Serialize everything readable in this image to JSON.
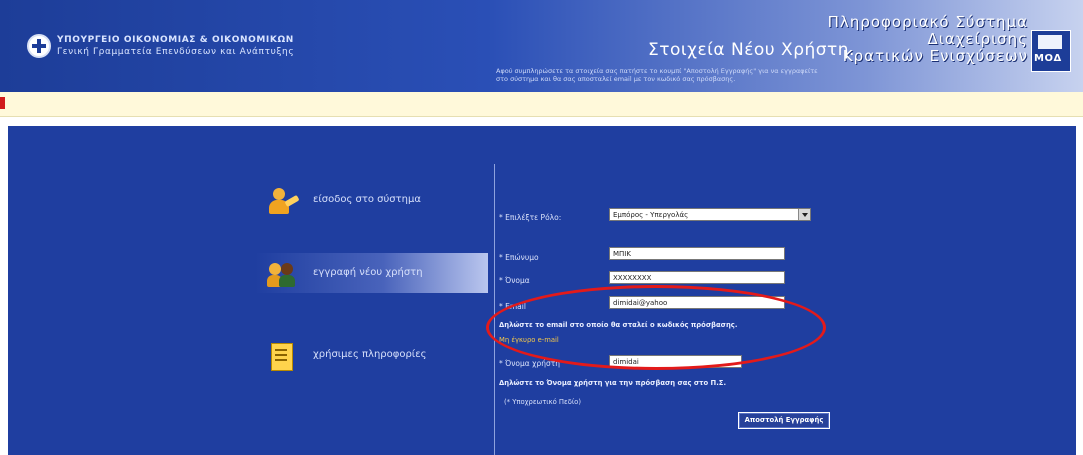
{
  "header": {
    "ministry_line1": "ΥΠΟΥΡΓΕΙΟ ΟΙΚΟΝΟΜΙΑΣ & ΟΙΚΟΝΟΜΙΚΩΝ",
    "ministry_line2": "Γενική Γραμματεία Επενδύσεων και Ανάπτυξης",
    "system_title_line1": "Πληροφοριακό Σύστημα",
    "system_title_line2": "Διαχείρισης",
    "system_title_line3": "Κρατικών Ενισχύσεων",
    "logo_text": "ΜΟΔ"
  },
  "nav": {
    "items": [
      {
        "label": "είσοδος στο σύστημα",
        "icon": "login-key-icon"
      },
      {
        "label": "εγγραφή νέου χρήστη",
        "icon": "users-icon"
      },
      {
        "label": "χρήσιμες πληροφορίες",
        "icon": "info-document-icon"
      }
    ],
    "active_index": 1
  },
  "form": {
    "title": "Στοιχεία Νέου Χρήστη.",
    "intro": "Αφού συμπληρώσετε τα στοιχεία σας πατήστε το κουμπί \"Αποστολή Εγγραφής\" για να εγγραφείτε στο σύστημα και θα σας αποσταλεί email με τον κωδικό σας πρόσβασης.",
    "role_label": "* Επιλέξτε Ρόλο:",
    "role_value": "Εμπόρος - Υπεργολάς",
    "surname_label": "* Επώνυμο",
    "surname_value": "ΜΠΙΚ",
    "name_label": "* Όνομα",
    "name_value": "ΧΧΧΧΧΧΧΧ",
    "email_label": "* Email",
    "email_value": "dimidai@yahoo",
    "email_note": "Δηλώστε το email στο οποίο θα σταλεί ο κωδικός πρόσβασης.",
    "email_link": "Μη έγκυρο e-mail",
    "username_label": "* Όνομα χρήστη",
    "username_value": "dimidai",
    "username_note": "Δηλώστε το Όνομα χρήστη για την πρόσβαση σας στο Π.Σ.",
    "required_note": "(* Υποχρεωτικό Πεδίο)",
    "next_button": "Αποστολή Εγγραφής"
  },
  "colors": {
    "header_start": "#1d3d98",
    "main_background": "#1f3ea0",
    "highlight": "#e31a1a",
    "error_link": "#f2c84b"
  }
}
